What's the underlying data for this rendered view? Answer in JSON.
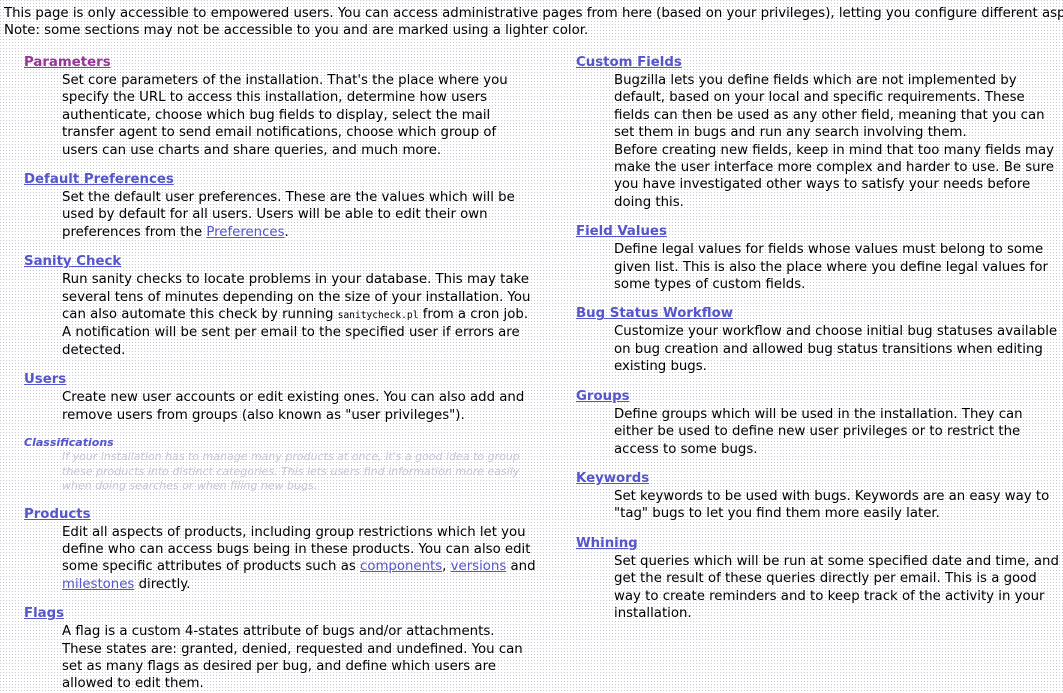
{
  "intro": {
    "line1": "This page is only accessible to empowered users. You can access administrative pages from here (based on your privileges), letting you configure different aspects of this installation.",
    "line2": "Note: some sections may not be accessible to you and are marked using a lighter color."
  },
  "colors": {
    "link": "#5555cc",
    "link_visited": "#99339b",
    "disabled_text": "#c6c6d8",
    "background": "#ffffff",
    "dot": "#c9c9d2"
  },
  "left_column": [
    {
      "title": "Parameters",
      "state": "visited",
      "disabled": false,
      "paragraphs": [
        "Set core parameters of the installation. That's the place where you specify the URL to access this installation, determine how users authenticate, choose which bug fields to display, select the mail transfer agent to send email notifications, choose which group of users can use charts and share queries, and much more."
      ]
    },
    {
      "title": "Default Preferences",
      "state": "normal",
      "disabled": false,
      "rich": true,
      "parts": [
        {
          "type": "text",
          "value": "Set the default user preferences. These are the values which will be used by default for all users. Users will be able to edit their own preferences from the "
        },
        {
          "type": "link",
          "value": "Preferences"
        },
        {
          "type": "text",
          "value": "."
        }
      ]
    },
    {
      "title": "Sanity Check",
      "state": "normal",
      "disabled": false,
      "rich": true,
      "parts": [
        {
          "type": "text",
          "value": "Run sanity checks to locate problems in your database. This may take several tens of minutes depending on the size of your installation. You can also automate this check by running "
        },
        {
          "type": "code",
          "value": "sanitycheck.pl"
        },
        {
          "type": "text",
          "value": " from a cron job. A notification will be sent per email to the specified user if errors are detected."
        }
      ]
    },
    {
      "title": "Users",
      "state": "normal",
      "disabled": false,
      "paragraphs": [
        "Create new user accounts or edit existing ones. You can also add and remove users from groups (also known as \"user privileges\")."
      ]
    },
    {
      "title": "Classifications",
      "state": "normal",
      "disabled": true,
      "paragraphs": [
        "If your installation has to manage many products at once, it's a good idea to group these products into distinct categories. This lets users find information more easily when doing searches or when filing new bugs."
      ]
    },
    {
      "title": "Products",
      "state": "normal",
      "disabled": false,
      "rich": true,
      "parts": [
        {
          "type": "text",
          "value": "Edit all aspects of products, including group restrictions which let you define who can access bugs being in these products. You can also edit some specific attributes of products such as "
        },
        {
          "type": "link",
          "value": "components"
        },
        {
          "type": "text",
          "value": ", "
        },
        {
          "type": "link",
          "value": "versions"
        },
        {
          "type": "text",
          "value": " and "
        },
        {
          "type": "link",
          "value": "milestones"
        },
        {
          "type": "text",
          "value": " directly."
        }
      ]
    },
    {
      "title": "Flags",
      "state": "normal",
      "disabled": false,
      "paragraphs": [
        "A flag is a custom 4-states attribute of bugs and/or attachments. These states are: granted, denied, requested and undefined. You can set as many flags as desired per bug, and define which users are allowed to edit them."
      ]
    }
  ],
  "right_column": [
    {
      "title": "Custom Fields",
      "state": "normal",
      "disabled": false,
      "paragraphs": [
        "Bugzilla lets you define fields which are not implemented by default, based on your local and specific requirements. These fields can then be used as any other field, meaning that you can set them in bugs and run any search involving them.",
        "Before creating new fields, keep in mind that too many fields may make the user interface more complex and harder to use. Be sure you have investigated other ways to satisfy your needs before doing this."
      ]
    },
    {
      "title": "Field Values",
      "state": "normal",
      "disabled": false,
      "paragraphs": [
        "Define legal values for fields whose values must belong to some given list. This is also the place where you define legal values for some types of custom fields."
      ]
    },
    {
      "title": "Bug Status Workflow",
      "state": "normal",
      "disabled": false,
      "paragraphs": [
        "Customize your workflow and choose initial bug statuses available on bug creation and allowed bug status transitions when editing existing bugs."
      ]
    },
    {
      "title": "Groups",
      "state": "normal",
      "disabled": false,
      "paragraphs": [
        "Define groups which will be used in the installation. They can either be used to define new user privileges or to restrict the access to some bugs."
      ]
    },
    {
      "title": "Keywords",
      "state": "normal",
      "disabled": false,
      "paragraphs": [
        "Set keywords to be used with bugs. Keywords are an easy way to \"tag\" bugs to let you find them more easily later."
      ]
    },
    {
      "title": "Whining",
      "state": "normal",
      "disabled": false,
      "paragraphs": [
        "Set queries which will be run at some specified date and time, and get the result of these queries directly per email. This is a good way to create reminders and to keep track of the activity in your installation."
      ]
    }
  ]
}
